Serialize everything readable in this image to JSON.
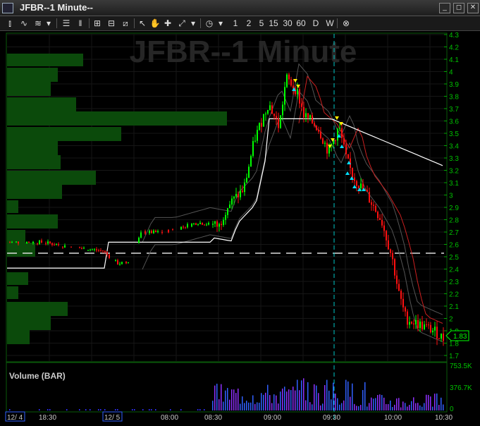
{
  "window": {
    "title": "JFBR--1 Minute--",
    "min": "_",
    "restore": "◻",
    "close": "✕"
  },
  "toolbar": {
    "intervals": [
      "1",
      "2",
      "5",
      "15",
      "30",
      "60",
      "D",
      "W"
    ]
  },
  "chart": {
    "watermark": "JFBR--1 Minute",
    "price_labels": [
      "4.3",
      "4.2",
      "4.1",
      "4",
      "3.9",
      "3.8",
      "3.7",
      "3.6",
      "3.5",
      "3.4",
      "3.3",
      "3.2",
      "3.1",
      "3",
      "2.9",
      "2.8",
      "2.7",
      "2.6",
      "2.5",
      "2.4",
      "2.3",
      "2.2",
      "2.1",
      "2",
      "1.9",
      "1.8",
      "1.7"
    ],
    "last_price": "1.83",
    "volume_title": "Volume (BAR)",
    "volume_labels": [
      "753.5K",
      "376.7K",
      "0"
    ],
    "time_labels": [
      {
        "t": "12/ 4",
        "boxed": true
      },
      {
        "t": "18:30",
        "boxed": false
      },
      {
        "t": "12/ 5",
        "boxed": true
      },
      {
        "t": "08:00",
        "boxed": false
      },
      {
        "t": "08:30",
        "boxed": false
      },
      {
        "t": "09:00",
        "boxed": false
      },
      {
        "t": "09:30",
        "boxed": false
      },
      {
        "t": "10:00",
        "boxed": false
      },
      {
        "t": "10:30",
        "boxed": false
      }
    ],
    "colors": {
      "up": "#00ff00",
      "down": "#ff1010",
      "vwap": "#ffffff",
      "band_red": "#cc2020",
      "profile": "#0b4a0b",
      "axis": "#00aa00"
    }
  }
}
